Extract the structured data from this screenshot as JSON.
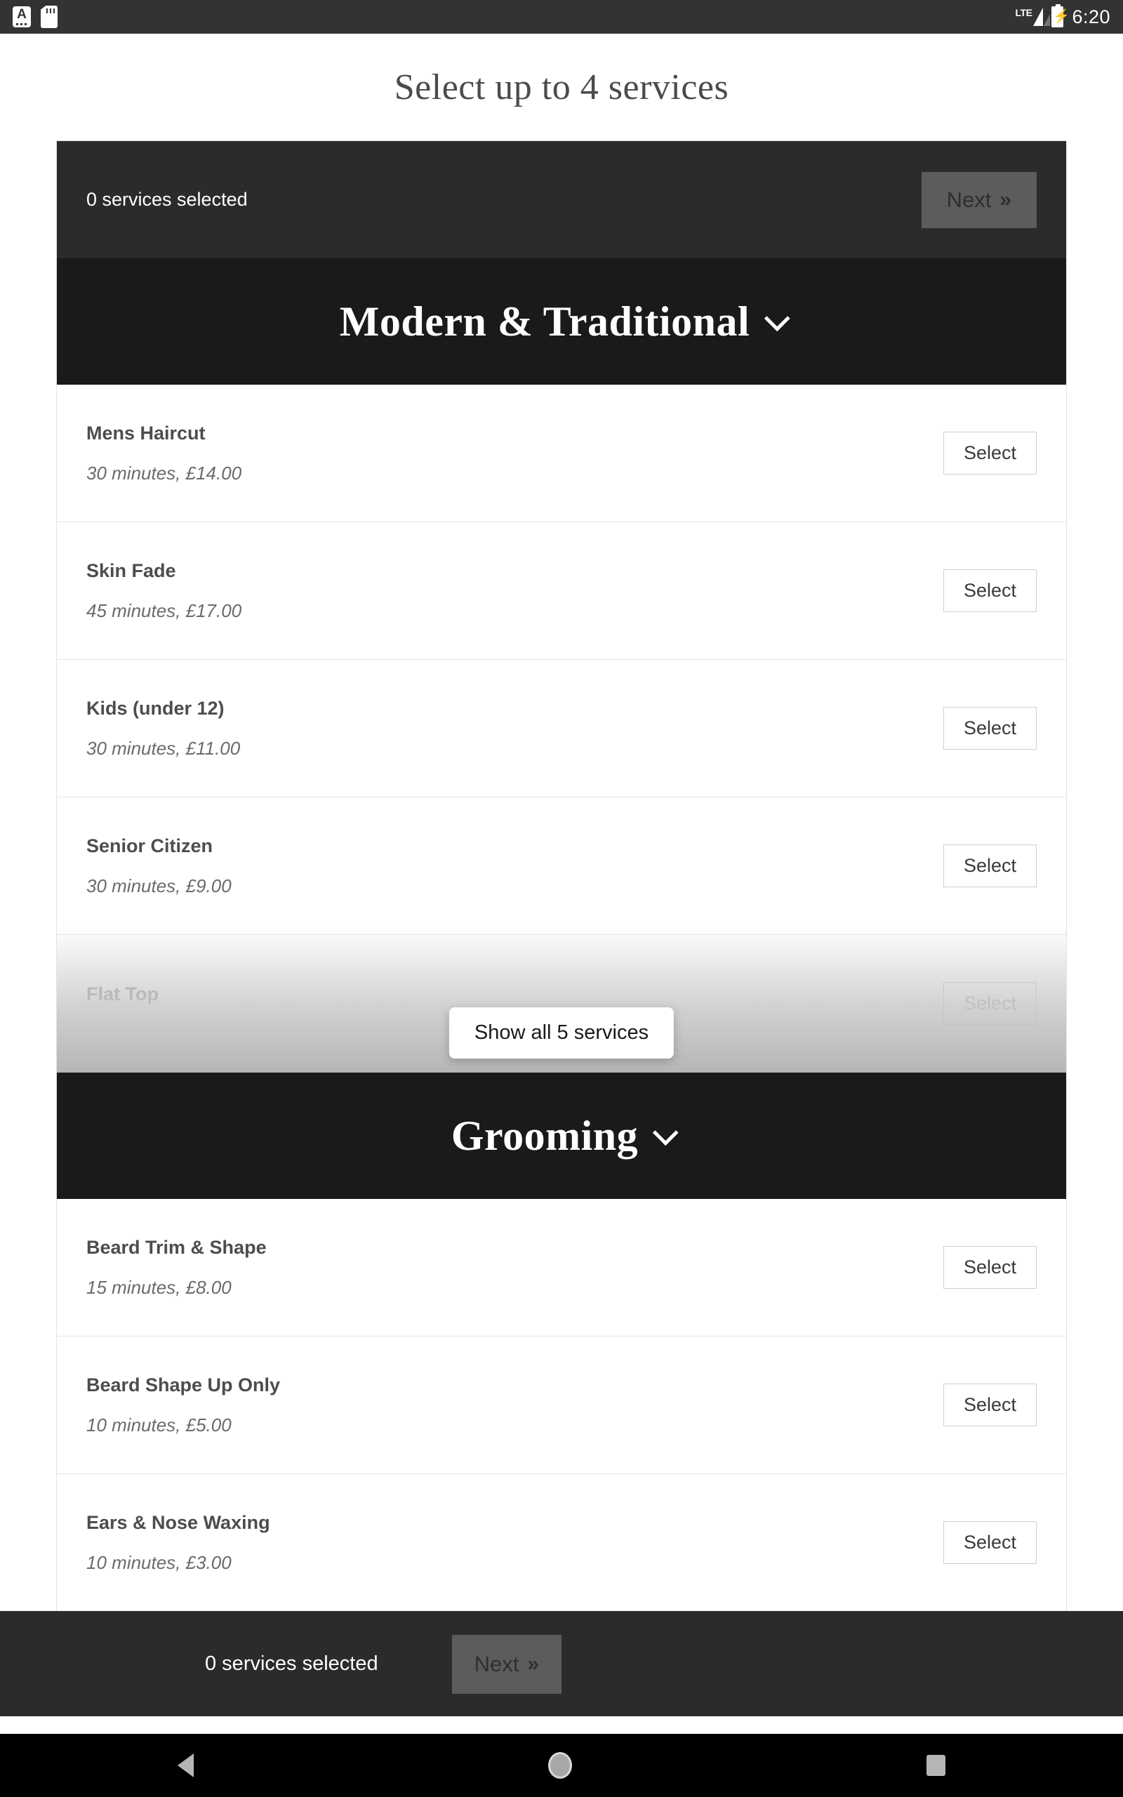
{
  "status_bar": {
    "icons": [
      "keyboard-a-icon",
      "sd-card-icon",
      "lte-signal-icon",
      "battery-charging-icon"
    ],
    "network_label": "LTE",
    "time": "6:20"
  },
  "page": {
    "title": "Select up to 4 services"
  },
  "summary_top": {
    "count_label": "0 services selected",
    "next_label": "Next",
    "next_chevron": "»"
  },
  "summary_bottom": {
    "count_label": "0 services selected",
    "next_label": "Next",
    "next_chevron": "»"
  },
  "sections": [
    {
      "title": "Modern & Traditional",
      "collapsed_overlay": true,
      "show_all_label": "Show all 5 services",
      "services": [
        {
          "name": "Mens Haircut",
          "meta": "30 minutes, £14.00",
          "select_label": "Select"
        },
        {
          "name": "Skin Fade",
          "meta": "45 minutes, £17.00",
          "select_label": "Select"
        },
        {
          "name": "Kids (under 12)",
          "meta": "30 minutes, £11.00",
          "select_label": "Select"
        },
        {
          "name": "Senior Citizen",
          "meta": "30 minutes, £9.00",
          "select_label": "Select"
        },
        {
          "name": "Flat Top",
          "meta": "",
          "select_label": "Select"
        }
      ]
    },
    {
      "title": "Grooming",
      "collapsed_overlay": false,
      "services": [
        {
          "name": "Beard Trim & Shape",
          "meta": "15 minutes, £8.00",
          "select_label": "Select"
        },
        {
          "name": "Beard Shape Up Only",
          "meta": "10 minutes, £5.00",
          "select_label": "Select"
        },
        {
          "name": "Ears & Nose Waxing",
          "meta": "10 minutes, £3.00",
          "select_label": "Select"
        }
      ]
    }
  ],
  "colors": {
    "summary_bar": "#2b2b2b",
    "section_header": "#1a1a1a",
    "next_button": "#5c5c5c",
    "page_background": "#ffffff",
    "title_text": "#4b4b4b"
  },
  "nav_bar": {
    "buttons": [
      "back-button",
      "home-button",
      "recents-button"
    ]
  }
}
